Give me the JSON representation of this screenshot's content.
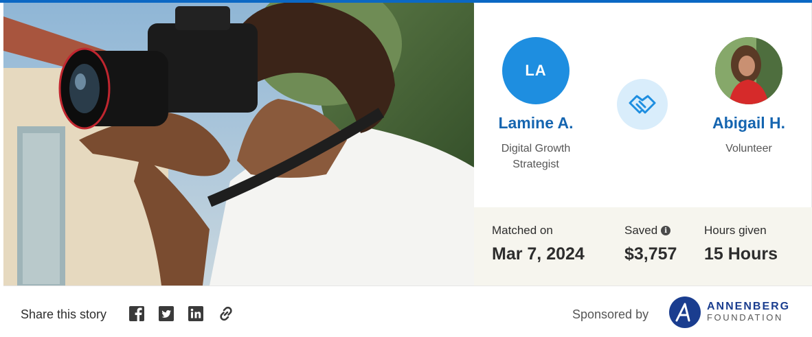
{
  "mentor": {
    "initials": "LA",
    "name": "Lamine A.",
    "role_line1": "Digital Growth",
    "role_line2": "Strategist"
  },
  "mentee": {
    "name": "Abigail H.",
    "role": "Volunteer"
  },
  "stats": {
    "matched_label": "Matched on",
    "matched_value": "Mar 7, 2024",
    "saved_label": "Saved",
    "saved_value": "$3,757",
    "hours_label": "Hours given",
    "hours_value": "15 Hours"
  },
  "footer": {
    "share_label": "Share this story",
    "share_icons": [
      "facebook-icon",
      "twitter-icon",
      "linkedin-icon",
      "link-icon"
    ],
    "sponsored_label": "Sponsored by",
    "sponsor_line1": "ANNENBERG",
    "sponsor_line2": "FOUNDATION"
  },
  "colors": {
    "accent_blue": "#1565b0",
    "avatar_blue": "#1e8ee0",
    "handshake_bg": "#d9edfb",
    "stats_bg": "#f6f5ee"
  }
}
